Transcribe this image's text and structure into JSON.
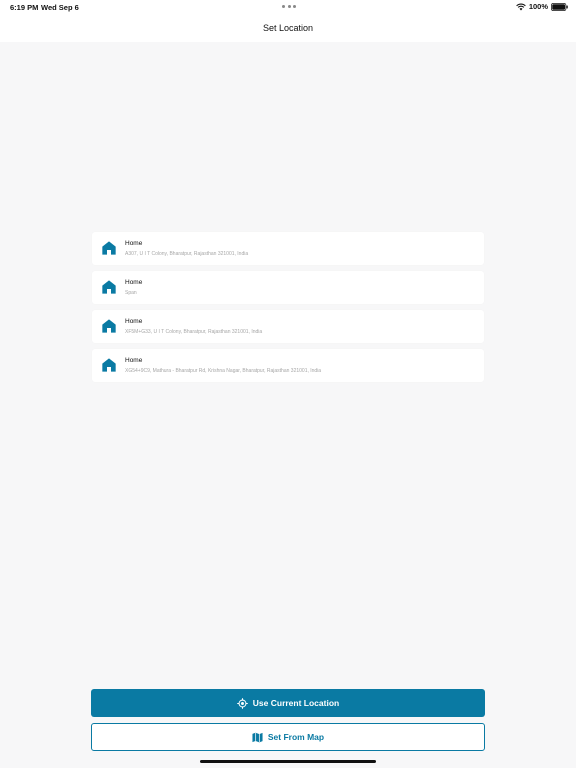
{
  "status_bar": {
    "time": "6:19 PM",
    "date": "Wed Sep 6",
    "battery": "100%"
  },
  "nav": {
    "title": "Set Location"
  },
  "addresses": [
    {
      "title": "Home",
      "subtitle": "A307, U I T Colony, Bharatpur, Rajasthan 321001, India"
    },
    {
      "title": "Home",
      "subtitle": "Span"
    },
    {
      "title": "Home",
      "subtitle": "XF5M+G33, U I T Colony, Bharatpur, Rajasthan 321001, India"
    },
    {
      "title": "Home",
      "subtitle": "XG54+9C9, Mathura - Bharatpur Rd, Krishna Nagar, Bharatpur, Rajasthan 321001, India"
    }
  ],
  "buttons": {
    "use_current_location": "Use Current Location",
    "set_from_map": "Set From Map"
  },
  "icons": {
    "home": "home-icon",
    "location": "crosshair-icon",
    "map": "map-icon"
  },
  "colors": {
    "accent": "#0a7aa3",
    "background": "#f7f7f8"
  }
}
